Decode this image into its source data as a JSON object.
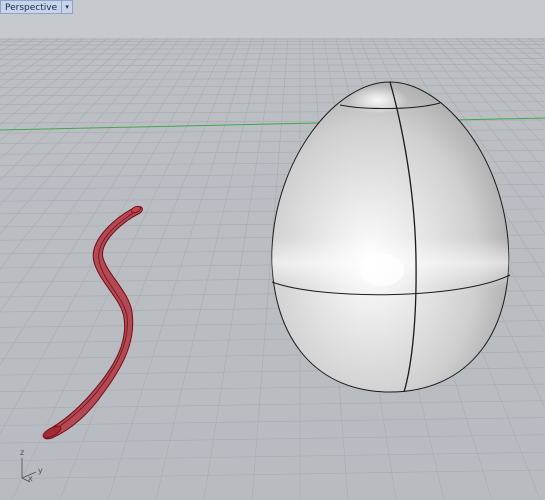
{
  "viewport": {
    "name": "Perspective",
    "menu_arrow": "▾",
    "background_top": "#bfc3c8",
    "background_bottom": "#b5b9be",
    "grid_color": "#a9adb3",
    "x_axis_color": "#3fa74a"
  },
  "axis_gizmo": {
    "z_label": "z",
    "x_label": "x",
    "y_label": "y"
  },
  "objects": [
    {
      "name": "egg-surface",
      "color": "#d8d8d8",
      "edge_color": "#1a1a1a"
    },
    {
      "name": "curved-tube",
      "color": "#b3303a",
      "edge_color": "#6e0f18"
    }
  ]
}
